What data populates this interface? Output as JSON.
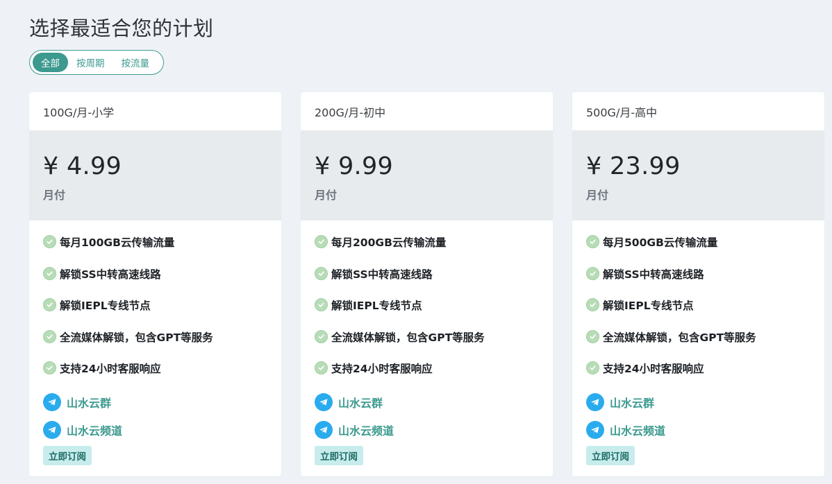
{
  "title": "选择最适合您的计划",
  "filters": [
    {
      "label": "全部",
      "active": true
    },
    {
      "label": "按周期",
      "active": false
    },
    {
      "label": "按流量",
      "active": false
    }
  ],
  "plans": [
    {
      "name": "100G/月-小学",
      "price": "¥ 4.99",
      "period": "月付",
      "features": [
        "每月100GB云传输流量",
        "解锁SS中转高速线路",
        "解锁IEPL专线节点",
        "全流媒体解锁，包含GPT等服务",
        "支持24小时客服响应"
      ],
      "links": [
        "山水云群",
        "山水云频道"
      ],
      "cta": "立即订阅"
    },
    {
      "name": "200G/月-初中",
      "price": "¥ 9.99",
      "period": "月付",
      "features": [
        "每月200GB云传输流量",
        "解锁SS中转高速线路",
        "解锁IEPL专线节点",
        "全流媒体解锁，包含GPT等服务",
        "支持24小时客服响应"
      ],
      "links": [
        "山水云群",
        "山水云频道"
      ],
      "cta": "立即订阅"
    },
    {
      "name": "500G/月-高中",
      "price": "¥ 23.99",
      "period": "月付",
      "features": [
        "每月500GB云传输流量",
        "解锁SS中转高速线路",
        "解锁IEPL专线节点",
        "全流媒体解锁，包含GPT等服务",
        "支持24小时客服响应"
      ],
      "links": [
        "山水云群",
        "山水云频道"
      ],
      "cta": "立即订阅"
    }
  ],
  "icons": {
    "feature": "check-circle-icon",
    "link": "telegram-icon"
  },
  "colors": {
    "accent": "#3c9a8f",
    "background": "#eef2f7",
    "price_bg": "#e8ebee",
    "check": "#b8dcb7",
    "telegram": "#2aabee",
    "button_bg": "#c8ecec"
  }
}
